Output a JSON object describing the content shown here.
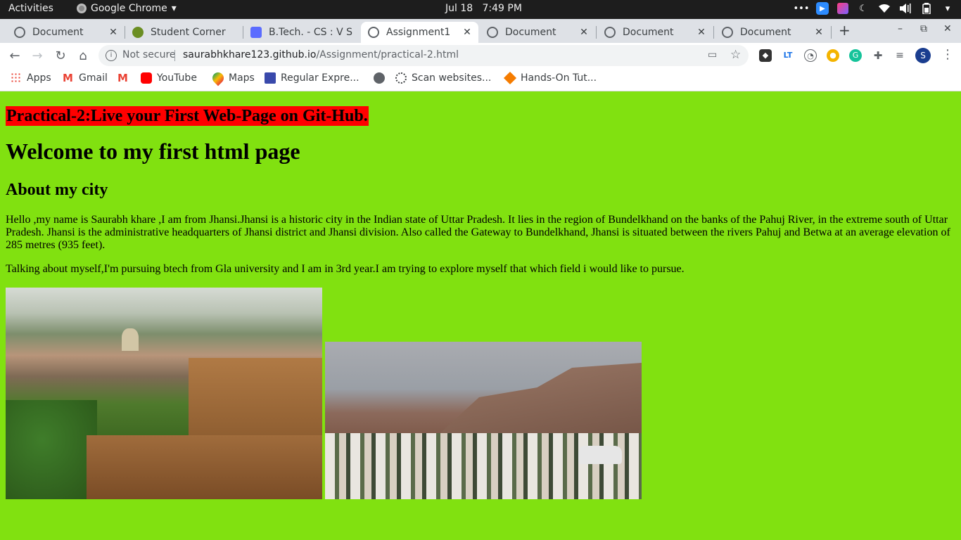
{
  "system_bar": {
    "activities": "Activities",
    "app_name": "Google Chrome",
    "app_caret": "▾",
    "date": "Jul 18",
    "time": "7:49 PM"
  },
  "tabs": [
    {
      "title": "Document",
      "favicon": "globe-icon",
      "active": false
    },
    {
      "title": "Student Corner",
      "favicon": "frog-icon",
      "active": false
    },
    {
      "title": "B.Tech. - CS : V S",
      "favicon": "meet-icon",
      "active": false
    },
    {
      "title": "Assignment1",
      "favicon": "globe-icon",
      "active": true
    },
    {
      "title": "Document",
      "favicon": "globe-icon",
      "active": false
    },
    {
      "title": "Document",
      "favicon": "globe-icon",
      "active": false
    },
    {
      "title": "Document",
      "favicon": "globe-icon",
      "active": false
    }
  ],
  "tab_close_glyph": "✕",
  "new_tab_glyph": "+",
  "window_controls": {
    "minimize": "–",
    "maximize": "⧉",
    "close": "✕"
  },
  "omnibox": {
    "security_label": "Not secure",
    "host": "saurabhkhare123.github.io",
    "path": "/Assignment/practical-2.html"
  },
  "profile_initial": "S",
  "bookmarks": [
    {
      "label": "Apps",
      "icon": "apps-grid-icon"
    },
    {
      "label": "Gmail",
      "icon": "gmail-icon"
    },
    {
      "label": "",
      "icon": "gmail-icon"
    },
    {
      "label": "YouTube",
      "icon": "youtube-icon"
    },
    {
      "label": "Maps",
      "icon": "maps-icon"
    },
    {
      "label": "Regular Expre...",
      "icon": "regex-icon"
    },
    {
      "label": "",
      "icon": "globe-icon"
    },
    {
      "label": "Scan websites...",
      "icon": "scan-icon"
    },
    {
      "label": "Hands-On Tut...",
      "icon": "box-icon"
    }
  ],
  "page": {
    "practical_title": "Practical-2:Live your First Web-Page on Git-Hub.",
    "heading": "Welcome to my first html page",
    "subheading": "About my city",
    "paragraph1": "Hello ,my name is Saurabh khare ,I am from Jhansi.Jhansi is a historic city in the Indian state of Uttar Pradesh. It lies in the region of Bundelkhand on the banks of the Pahuj River, in the extreme south of Uttar Pradesh. Jhansi is the administrative headquarters of Jhansi district and Jhansi division. Also called the Gateway to Bundelkhand, Jhansi is situated between the rivers Pahuj and Betwa at an average elevation of 285 metres (935 feet).",
    "paragraph2": "Talking about myself,I'm pursuing btech from Gla university and I am in 3rd year.I am trying to explore myself that which field i would like to pursue.",
    "background_color": "#81e110",
    "title_highlight_color": "#ff0000"
  }
}
